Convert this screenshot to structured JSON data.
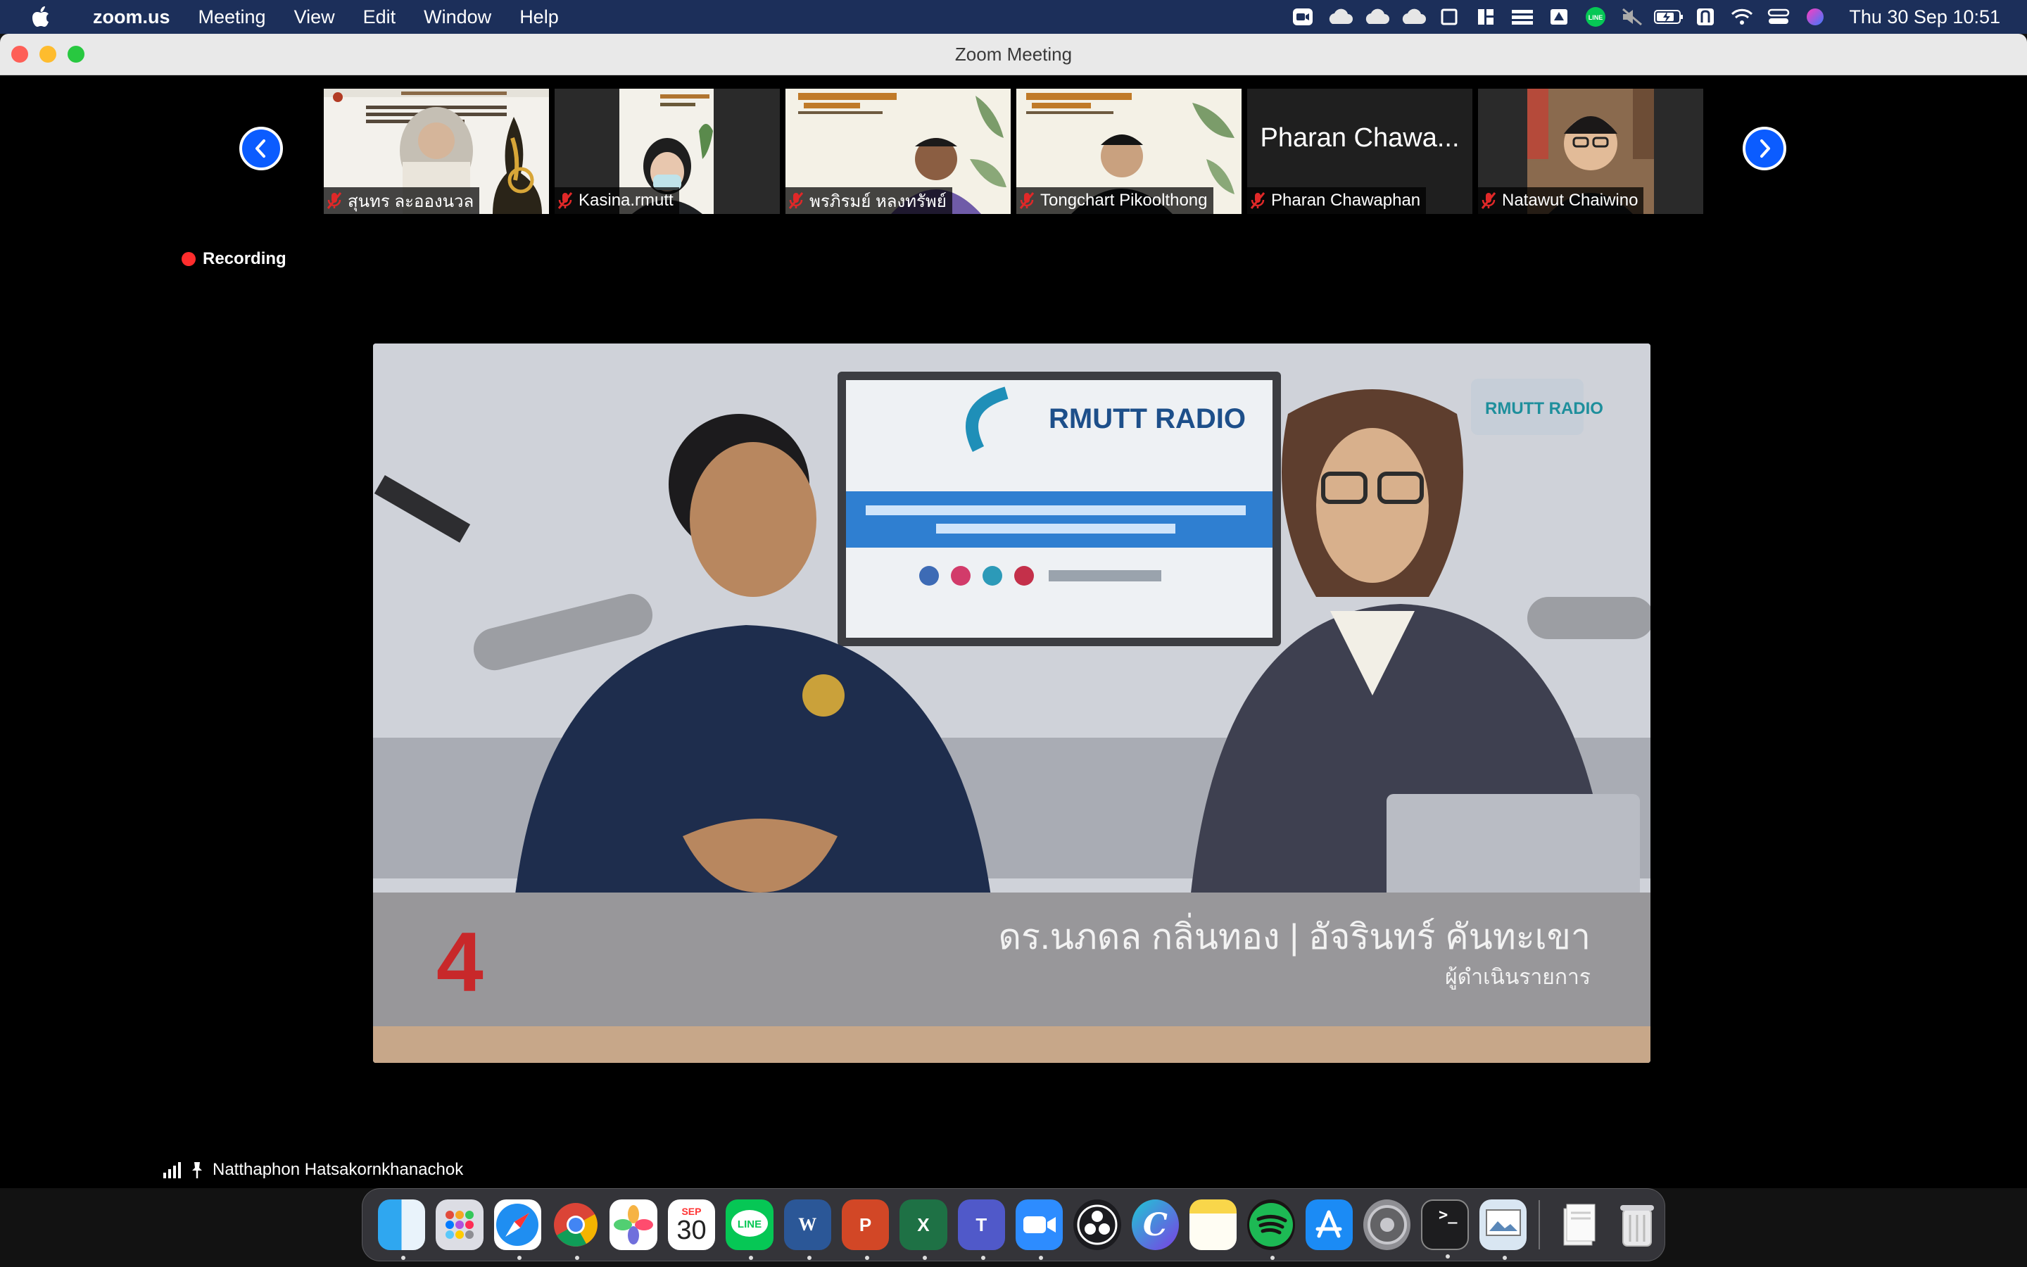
{
  "menubar": {
    "app_name": "zoom.us",
    "menus": [
      "Meeting",
      "View",
      "Edit",
      "Window",
      "Help"
    ],
    "clock": "Thu 30 Sep  10:51",
    "status_icons": [
      "zoom-icon",
      "cloud-icon",
      "cloud-icon",
      "cloud-icon",
      "screen-icon",
      "layout-icon",
      "stack-icon",
      "drive-icon",
      "line-icon",
      "mute-icon",
      "battery-icon",
      "thai-input-icon",
      "wifi-icon",
      "control-center-icon",
      "siri-icon"
    ]
  },
  "window": {
    "title": "Zoom Meeting"
  },
  "participants": [
    {
      "name": "สุนทร ละอองนวล",
      "muted": true,
      "kind": "slide"
    },
    {
      "name": "Kasina.rmutt",
      "muted": true,
      "kind": "video"
    },
    {
      "name": "พรภิรมย์ หลงทรัพย์",
      "muted": true,
      "kind": "video"
    },
    {
      "name": "Tongchart Pikoolthong",
      "muted": true,
      "kind": "video"
    },
    {
      "name": "Pharan Chawaphan",
      "display": "Pharan Chawa...",
      "muted": true,
      "kind": "name"
    },
    {
      "name": "Natawut Chaiwino",
      "muted": true,
      "kind": "video"
    }
  ],
  "stage": {
    "recording_label": "Recording",
    "active_speaker": "Natthaphon Hatsakornkhanachok",
    "video": {
      "logo_text": "RMUTT RADIO",
      "corner_logo": "RMUTT RADIO",
      "lower_third": "ดร.นภดล กลิ่นทอง | อัจรินทร์ คันทะเขา",
      "lower_third_sub": "ผู้ดำเนินรายการ",
      "badge": "4"
    }
  },
  "dock": {
    "calendar_month": "SEP",
    "calendar_day": "30",
    "apps": [
      "Finder",
      "Launchpad",
      "Safari",
      "Chrome",
      "Photos",
      "Calendar",
      "LINE",
      "Word",
      "PowerPoint",
      "Excel",
      "Teams",
      "Zoom",
      "OBS",
      "Canva",
      "Notes",
      "Spotify",
      "App Store",
      "System Preferences",
      "Terminal",
      "Preview",
      "Downloads",
      "Trash"
    ]
  },
  "colors": {
    "menubar": "#1c2f5a",
    "zoom_blue": "#0b5cff",
    "record_red": "#ff2d2d",
    "mute_red": "#e02828"
  }
}
